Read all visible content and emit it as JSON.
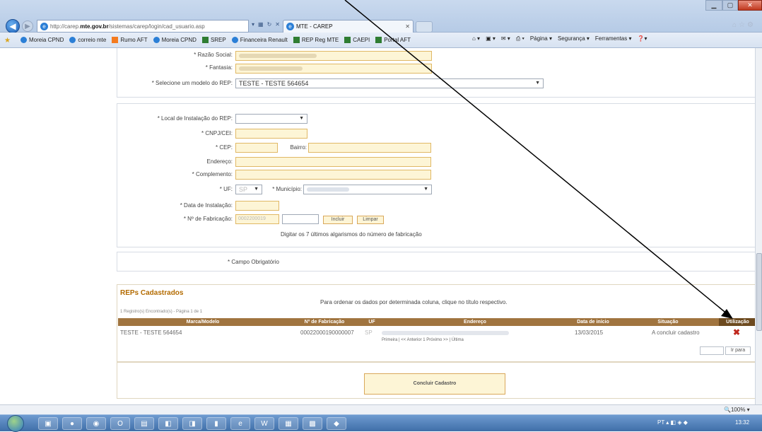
{
  "browser": {
    "address_prefix": "http://carep.",
    "address_domain": "mte.gov.br",
    "address_path": "/sistemas/carep/login/cad_usuario.asp",
    "tab_title": "MTE - CAREP",
    "favorites": [
      "Moreia CPND",
      "correio mte",
      "Rumo AFT",
      "Moreia CPND",
      "SREP",
      "Financeira Renault",
      "REP Reg MTE",
      "CAEPI",
      "Portal AFT"
    ],
    "commands": [
      "Página ▾",
      "Segurança ▾",
      "Ferramentas ▾"
    ]
  },
  "form": {
    "razao_social_label": "* Razão Social:",
    "fantasia_label": "* Fantasia:",
    "modelo_label": "* Selecione um modelo do REP:",
    "modelo_value": "TESTE - TESTE 564654",
    "local_label": "* Local de Instalação do REP:",
    "cnpj_label": "* CNPJ/CEI:",
    "cep_label": "* CEP:",
    "bairro_label": "Bairro:",
    "endereco_label": "Endereço:",
    "complemento_label": "* Complemento:",
    "uf_label": "* UF:",
    "uf_value": "SP",
    "municipio_label": "* Município:",
    "data_label": "* Data de Instalação:",
    "fabricacao_label": "* Nº de Fabricação:",
    "fabricacao_value": "0002200019",
    "incluir_label": "Incluir",
    "limpar_label": "Limpar",
    "fabricacao_hint": "Digitar os 7 últimos algarismos do número de fabricação",
    "obrigatorio": "* Campo Obrigatório"
  },
  "reps": {
    "title": "REPs Cadastrados",
    "sort_hint": "Para ordenar os dados por determinada coluna, clique no título respectivo.",
    "count": "1 Registro(s) Encontrado(s) - Página 1 de 1",
    "columns": [
      "Marca/Modelo",
      "Nº de Fabricação",
      "UF",
      "Endereço",
      "Data de início",
      "Situação",
      "Utilização"
    ],
    "row": {
      "modelo": "TESTE - TESTE 564654",
      "fabricacao": "00022000190000007",
      "uf": "SP",
      "data": "13/03/2015",
      "situacao": "A concluir cadastro",
      "utilizacao": "✖"
    },
    "pager": "Primeira | << Anterior 1 Próximo >> | Última",
    "ir_para": "Ir para"
  },
  "concluir_label": "Concluir Cadastro",
  "status": {
    "zoom": "100%",
    "time": "13:32"
  },
  "colors": {
    "header": "#a0743f",
    "input_bg": "#fdf5d6",
    "title": "#b36b00"
  }
}
